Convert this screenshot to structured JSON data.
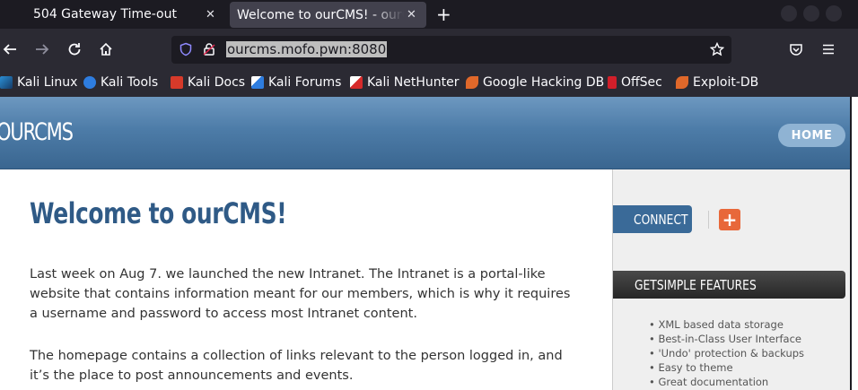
{
  "tabs": [
    {
      "title": "504 Gateway Time-out",
      "active": false
    },
    {
      "title": "Welcome to ourCMS! - ourCMS",
      "active": true
    }
  ],
  "nav": {
    "url": "ourcms.mofo.pwn:8080"
  },
  "bookmarks": [
    {
      "label": "Kali Linux",
      "icon": "kali-icon"
    },
    {
      "label": "Kali Tools",
      "icon": "kali-tools-icon"
    },
    {
      "label": "Kali Docs",
      "icon": "kali-docs-icon"
    },
    {
      "label": "Kali Forums",
      "icon": "kali-forums-icon"
    },
    {
      "label": "Kali NetHunter",
      "icon": "nethunter-icon"
    },
    {
      "label": "Google Hacking DB",
      "icon": "exploit-db-icon"
    },
    {
      "label": "OffSec",
      "icon": "offsec-icon"
    },
    {
      "label": "Exploit-DB",
      "icon": "exploit-db-icon"
    }
  ],
  "site": {
    "brand": "OURCMS",
    "home_label": "HOME"
  },
  "main": {
    "heading": "Welcome to ourCMS!",
    "paragraphs": [
      "Last week on Aug 7. we launched the new Intranet. The Intranet is a portal-like website that contains information meant for our members, which is why it requires a username and password to access most Intranet content.",
      "The homepage contains a collection of links relevant to the person logged in, and it’s the place to post announcements and events."
    ]
  },
  "sidebar": {
    "connect_label": "CONNECT",
    "features_title": "GETSIMPLE FEATURES",
    "features": [
      "XML based data storage",
      "Best-in-Class User Interface",
      "'Undo' protection & backups",
      "Easy to theme",
      "Great documentation"
    ]
  },
  "colors": {
    "header_blue": "#4d7ca8",
    "heading_blue": "#2f5a86",
    "plus_orange": "#e8683a"
  }
}
